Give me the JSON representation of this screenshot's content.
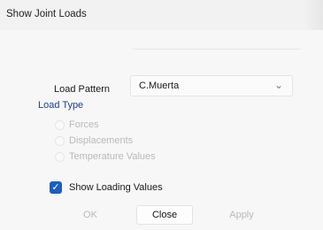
{
  "window": {
    "title": "Show Joint Loads"
  },
  "load_pattern": {
    "label": "Load Pattern",
    "selected_value": "C.Muerta",
    "chevron": "chevron-down-icon"
  },
  "load_type": {
    "label": "Load Type",
    "options": [
      {
        "label": "Forces",
        "enabled": false,
        "selected": false
      },
      {
        "label": "Displacements",
        "enabled": false,
        "selected": false
      },
      {
        "label": "Temperature Values",
        "enabled": false,
        "selected": false
      }
    ]
  },
  "show_loading_values": {
    "label": "Show Loading Values",
    "checked": true
  },
  "buttons": {
    "ok": "OK",
    "close": "Close",
    "apply": "Apply"
  },
  "colors": {
    "accent": "#1f5fbf",
    "group_label": "#1b3f8c",
    "disabled_text": "#b9b9b9",
    "background": "#f7f7f7"
  }
}
